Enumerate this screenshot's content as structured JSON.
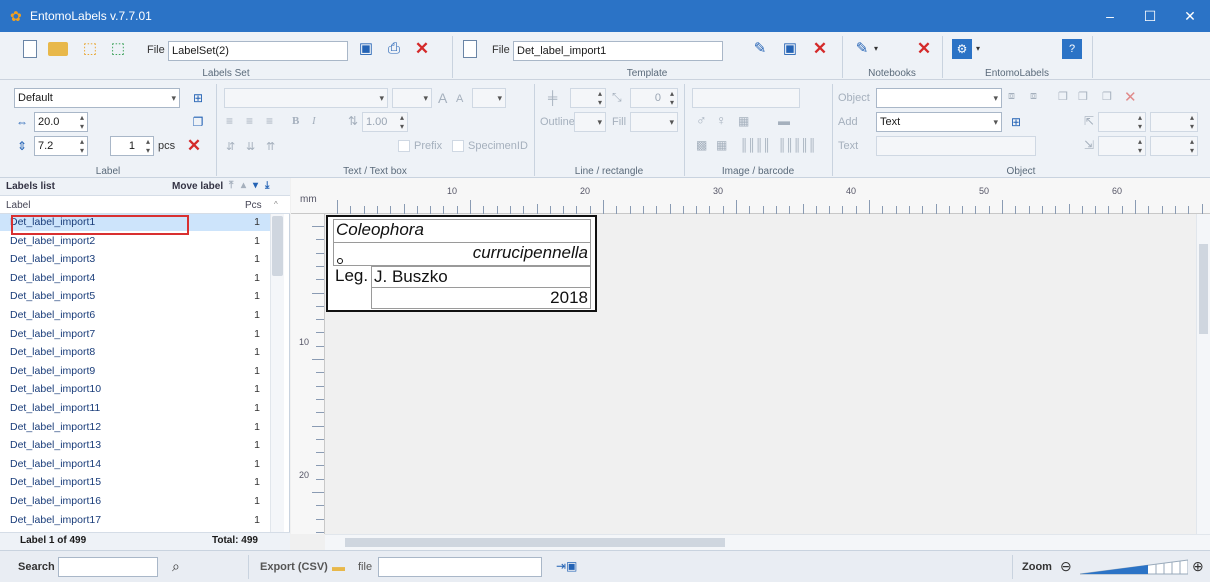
{
  "window": {
    "title": "EntomoLabels v.7.7.01",
    "minimize": "–",
    "maximize": "☐",
    "close": "✕"
  },
  "ribbon": {
    "labelset": {
      "file_label": "File",
      "file_value": "LabelSet(2)",
      "group_label": "Labels Set"
    },
    "template": {
      "file_label": "File",
      "file_value": "Det_label_import1",
      "group_label": "Template"
    },
    "notebooks": {
      "group_label": "Notebooks"
    },
    "entomolabels": {
      "group_label": "EntomoLabels"
    },
    "label_group": {
      "preset": "Default",
      "width": "20.0",
      "height": "7.2",
      "pcs_value": "1",
      "pcs_unit": "pcs",
      "group_label": "Label"
    },
    "textbox_group": {
      "line_spacing": "1.00",
      "prefix": "Prefix",
      "specimen_id": "SpecimenID",
      "group_label": "Text / Text box",
      "font_a_big": "A",
      "font_a_small": "A",
      "bold": "B",
      "italic": "I"
    },
    "line_group": {
      "outline": "Outline",
      "fill": "Fill",
      "angle": "0",
      "group_label": "Line / rectangle"
    },
    "image_group": {
      "group_label": "Image / barcode"
    },
    "object_group": {
      "object_label": "Object",
      "add_label": "Add",
      "add_value": "Text",
      "text_label": "Text",
      "group_label": "Object"
    }
  },
  "labels_list": {
    "header": "Labels list",
    "move_label": "Move label",
    "col_label": "Label",
    "col_pcs": "Pcs",
    "items": [
      {
        "name": "Det_label_import1",
        "pcs": "1"
      },
      {
        "name": "Det_label_import2",
        "pcs": "1"
      },
      {
        "name": "Det_label_import3",
        "pcs": "1"
      },
      {
        "name": "Det_label_import4",
        "pcs": "1"
      },
      {
        "name": "Det_label_import5",
        "pcs": "1"
      },
      {
        "name": "Det_label_import6",
        "pcs": "1"
      },
      {
        "name": "Det_label_import7",
        "pcs": "1"
      },
      {
        "name": "Det_label_import8",
        "pcs": "1"
      },
      {
        "name": "Det_label_import9",
        "pcs": "1"
      },
      {
        "name": "Det_label_import10",
        "pcs": "1"
      },
      {
        "name": "Det_label_import11",
        "pcs": "1"
      },
      {
        "name": "Det_label_import12",
        "pcs": "1"
      },
      {
        "name": "Det_label_import13",
        "pcs": "1"
      },
      {
        "name": "Det_label_import14",
        "pcs": "1"
      },
      {
        "name": "Det_label_import15",
        "pcs": "1"
      },
      {
        "name": "Det_label_import16",
        "pcs": "1"
      },
      {
        "name": "Det_label_import17",
        "pcs": "1"
      }
    ],
    "footer_position": "Label  1  of  499",
    "footer_total": "Total:  499"
  },
  "canvas": {
    "unit": "mm",
    "top_ruler_labels": [
      "10",
      "20",
      "30",
      "40",
      "50",
      "60"
    ],
    "left_ruler_labels": [
      "10",
      "20"
    ],
    "label_card": {
      "line1": "Coleophora",
      "line2": "currucipennella",
      "line3_prefix": "Leg.",
      "line3_value": "J. Buszko",
      "line4": "2018"
    }
  },
  "statusbar": {
    "search_label": "Search",
    "search_value": "",
    "export_label": "Export (CSV)",
    "file_label": "file",
    "file_value": "",
    "zoom_label": "Zoom"
  }
}
